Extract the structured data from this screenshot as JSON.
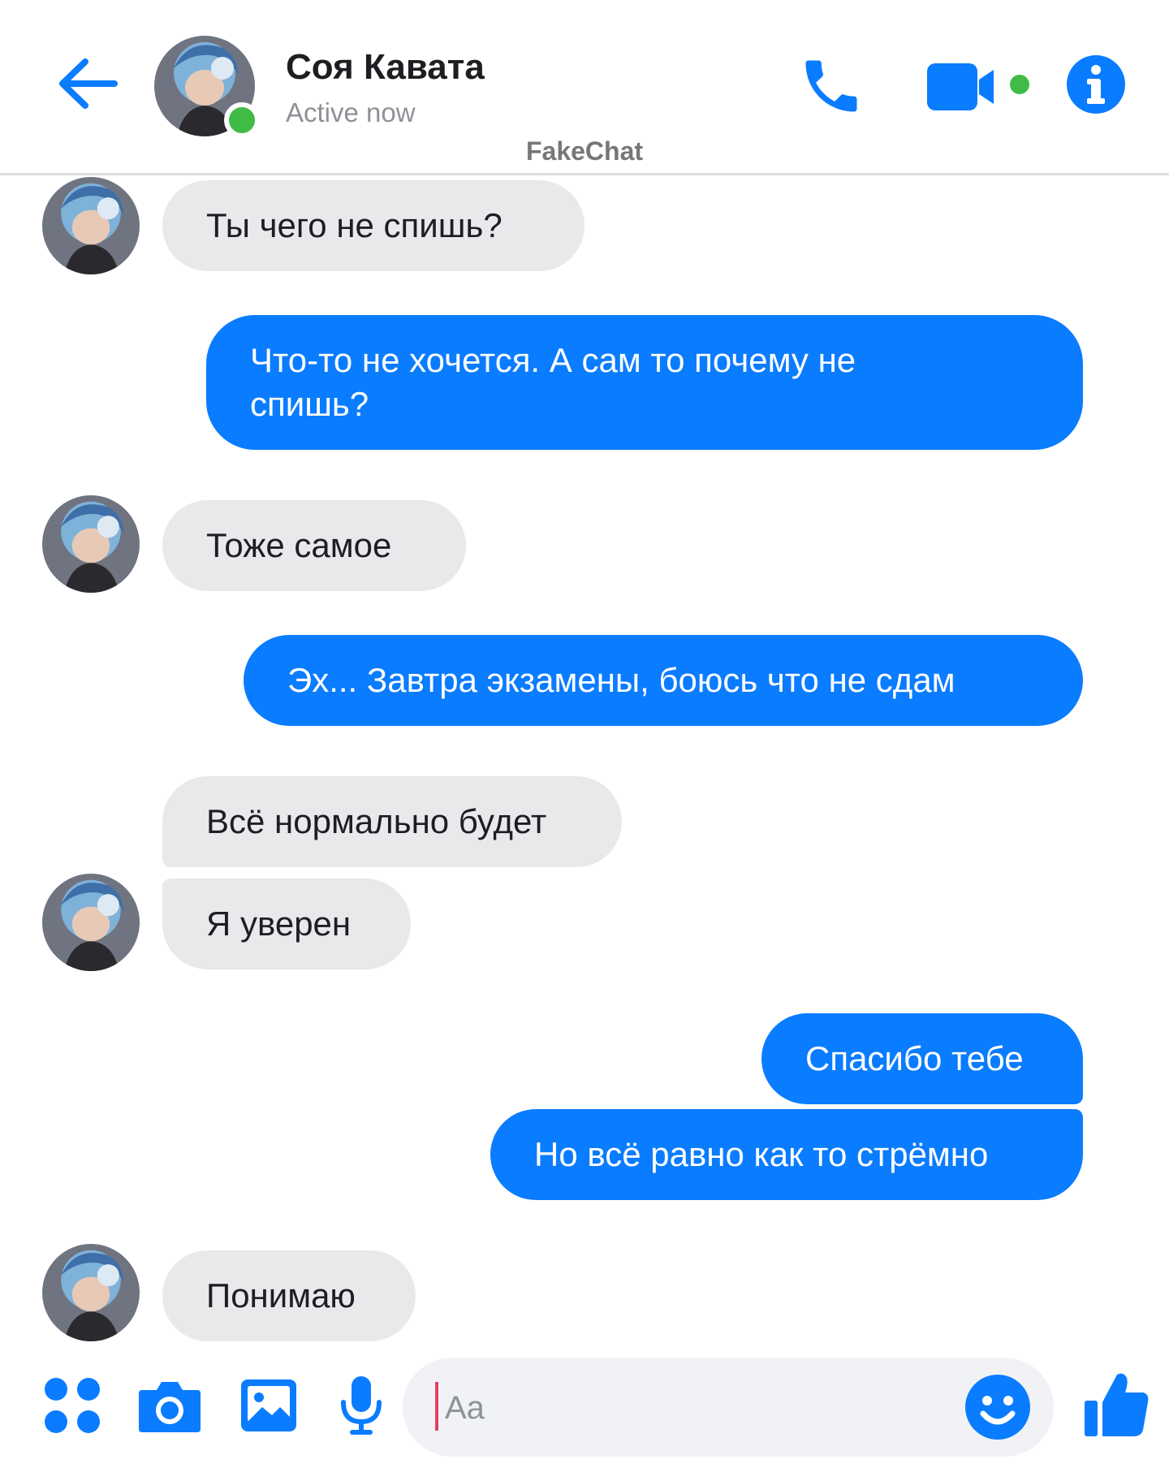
{
  "colors": {
    "accent": "#0a7cff",
    "incoming_bubble": "#e9e8eb",
    "online": "#3fbb46"
  },
  "header": {
    "contact_name": "Соя Кавата",
    "status": "Active now",
    "watermark": "FakeChat",
    "icons": {
      "back": "arrow-left-icon",
      "call": "phone-icon",
      "video": "video-camera-icon",
      "info": "info-icon"
    }
  },
  "messages": [
    {
      "side": "in",
      "text": "Ты чего не спишь?"
    },
    {
      "side": "out",
      "text": "Что-то не хочется. А сам то почему не спишь?"
    },
    {
      "side": "in",
      "text": "Тоже самое"
    },
    {
      "side": "out",
      "text": "Эх... Завтра экзамены, боюсь что не сдам"
    },
    {
      "side": "in",
      "text": "Всё нормально будет"
    },
    {
      "side": "in",
      "text": "Я уверен"
    },
    {
      "side": "out",
      "text": "Спасибо тебе"
    },
    {
      "side": "out",
      "text": "Но всё равно как то стрёмно"
    },
    {
      "side": "in",
      "text": "Понимаю"
    }
  ],
  "composer": {
    "placeholder": "Aa",
    "icons": {
      "menu": "four-dots-icon",
      "camera": "camera-icon",
      "gallery": "image-icon",
      "mic": "microphone-icon",
      "emoji": "smiley-icon",
      "like": "thumbs-up-icon"
    }
  }
}
